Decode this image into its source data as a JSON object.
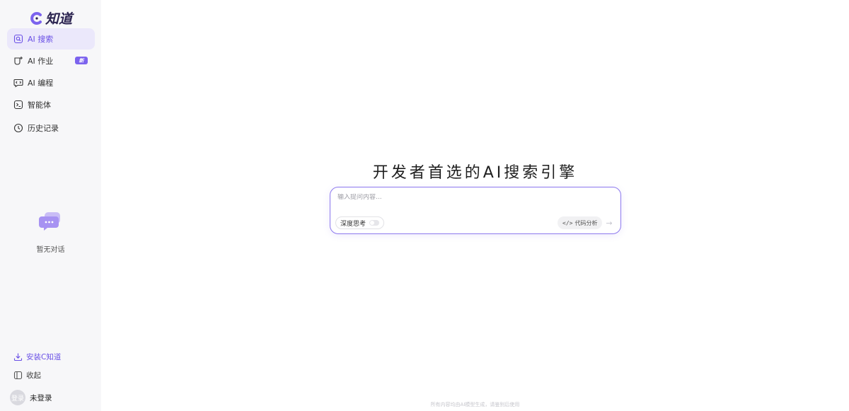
{
  "brand": {
    "name": "知道",
    "accent": "#7c63ee"
  },
  "sidebar": {
    "items": [
      {
        "label": "AI 搜索",
        "icon": "search-chat-icon",
        "active": true
      },
      {
        "label": "AI 作业",
        "icon": "homework-icon",
        "badge": "新"
      },
      {
        "label": "AI 编程",
        "icon": "code-chat-icon"
      },
      {
        "label": "智能体",
        "icon": "terminal-icon"
      },
      {
        "label": "历史记录",
        "icon": "clock-icon"
      }
    ],
    "empty_text": "暂无对话",
    "install_label": "安装C知道",
    "collapse_label": "收起",
    "avatar_text": "登录",
    "user_label": "未登录"
  },
  "main": {
    "headline": "开发者首选的AI搜索引擎",
    "input_placeholder": "输入提问内容...",
    "deep_think_label": "深度思考",
    "code_analysis_label": "代码分析",
    "code_analysis_icon": "</>",
    "footer": "所有内容均由AI模型生成，请鉴别后使用"
  }
}
